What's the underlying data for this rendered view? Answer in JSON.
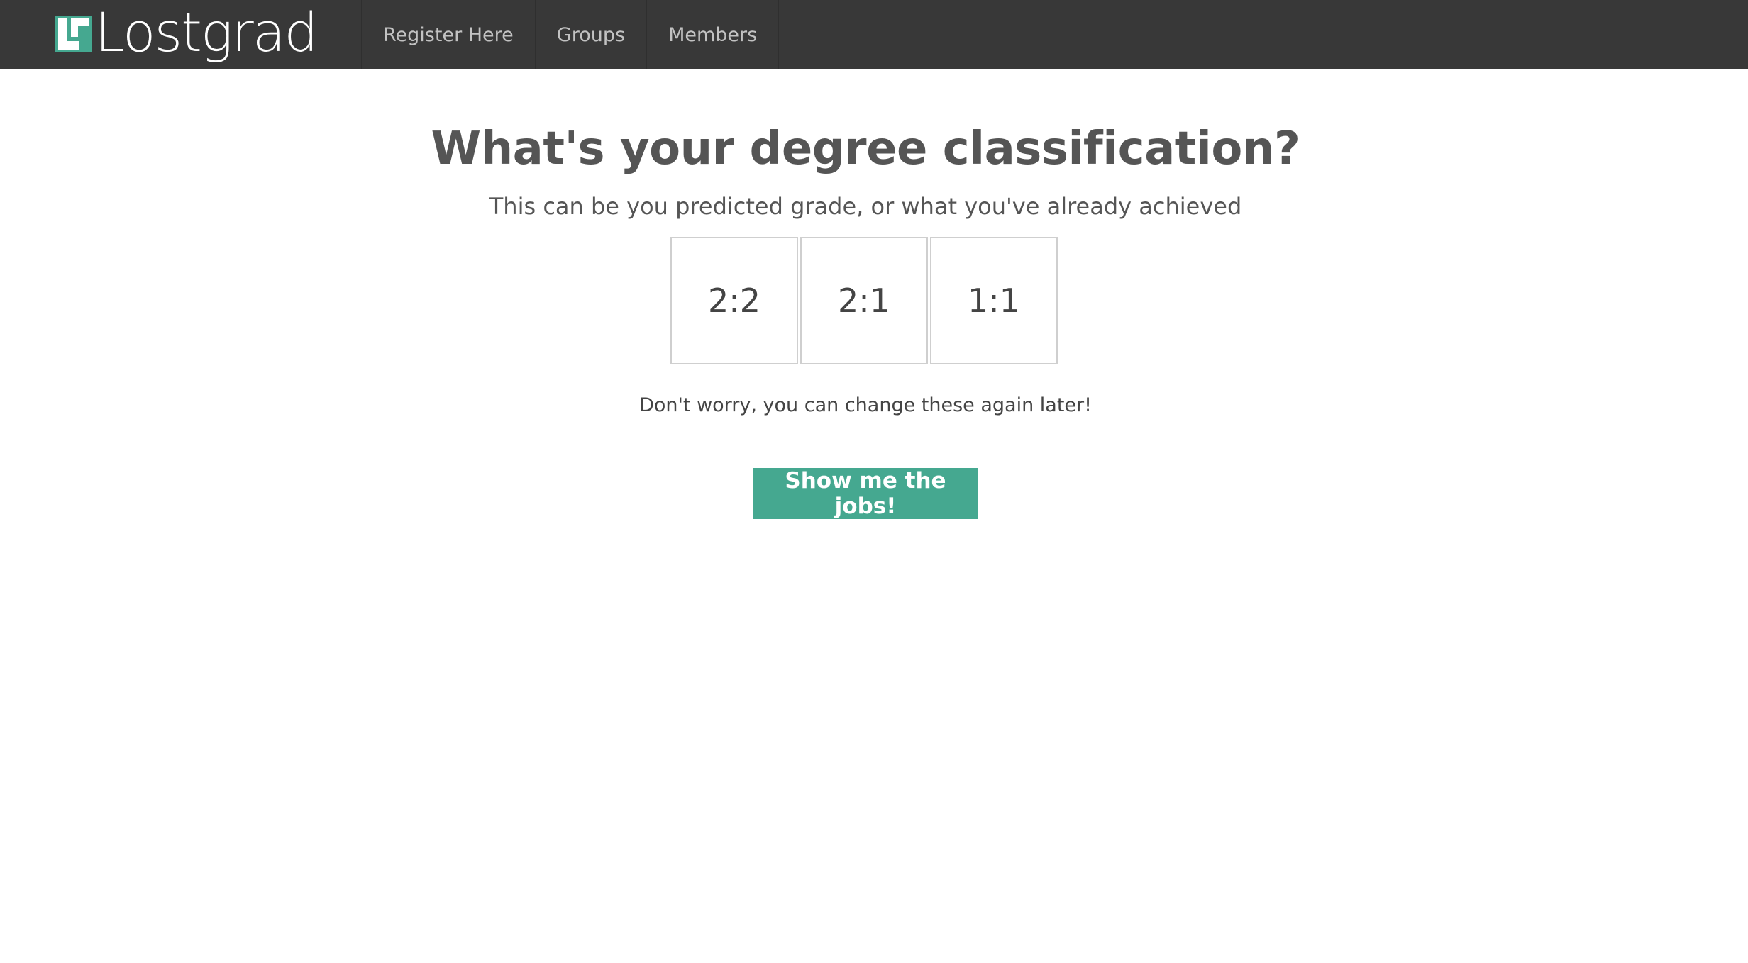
{
  "navbar": {
    "brand": "Lostgrad",
    "brand_color": "#45a890",
    "items": [
      {
        "label": "Register Here"
      },
      {
        "label": "Groups"
      },
      {
        "label": "Members"
      }
    ]
  },
  "main": {
    "title": "What's your degree classification?",
    "subtitle": "This can be you predicted grade, or what you've already achieved",
    "options": [
      {
        "label": "2:2"
      },
      {
        "label": "2:1"
      },
      {
        "label": "1:1"
      }
    ],
    "note": "Don't worry, you can change these again later!",
    "cta_label": "Show me the jobs!",
    "cta_color": "#45a890"
  }
}
